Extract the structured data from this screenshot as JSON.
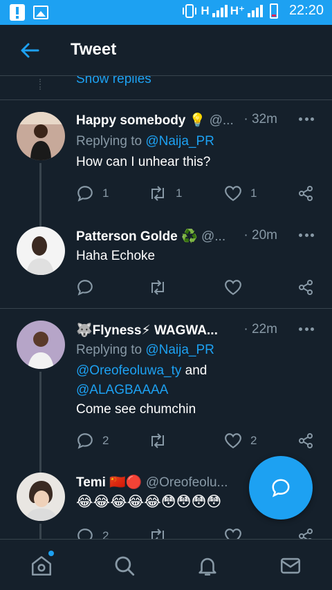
{
  "status_bar": {
    "network_1": "H",
    "network_2": "H⁺",
    "time": "22:20"
  },
  "header": {
    "title": "Tweet"
  },
  "show_replies": "Show replies",
  "tweets": [
    {
      "name": "Happy somebody 💡",
      "handle": "@...",
      "time": "· 32m",
      "replying_prefix": "Replying to ",
      "replying_to": "@Naija_PR",
      "text": "How can I unhear this?",
      "replies": "1",
      "retweets": "1",
      "likes": "1"
    },
    {
      "name": "Patterson Golde ♻️",
      "handle": "@...",
      "time": "· 20m",
      "text": "Haha Echoke",
      "replies": "",
      "retweets": "",
      "likes": ""
    },
    {
      "name": "🐺Flyness⚡ WAGWA...",
      "time": "· 22m",
      "replying_prefix": "Replying to ",
      "replying_to": "@Naija_PR",
      "mention_2": "@Oreofeoluwa_ty",
      "and_word": " and",
      "mention_3": "@ALAGBAAAA",
      "text": "Come see chumchin",
      "replies": "2",
      "retweets": "",
      "likes": "2"
    },
    {
      "name": "Temi 🇨🇳🔴",
      "handle": "@Oreofeolu...",
      "emojis": "😂😂😂😂😂😳😳😳😳",
      "replies": "2"
    }
  ],
  "colors": {
    "background": "#15202b",
    "accent": "#1da1f2",
    "secondary_text": "#8899a6",
    "border": "#38444d"
  }
}
